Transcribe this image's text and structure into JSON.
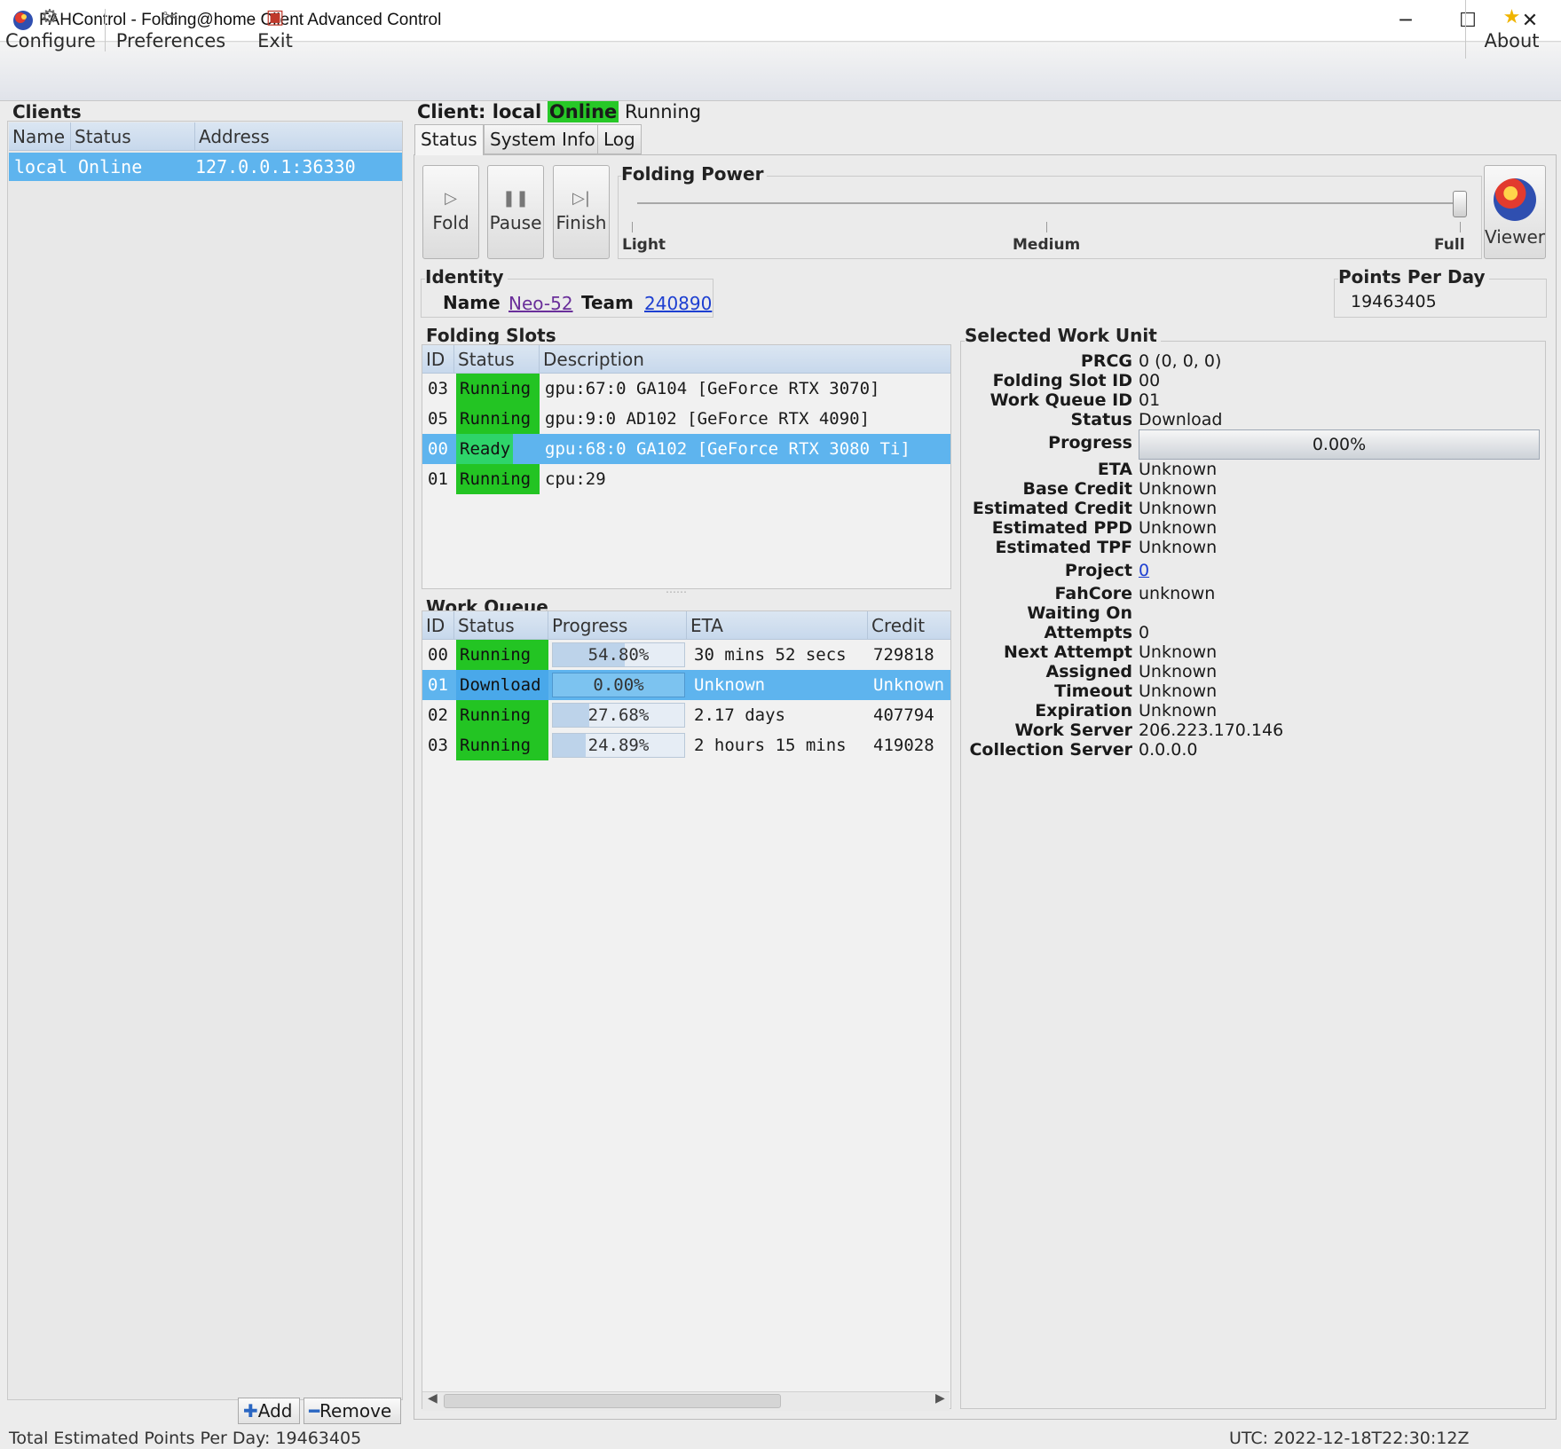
{
  "window": {
    "title": "FAHControl - Folding@home Client Advanced Control",
    "min": "─",
    "max": "☐",
    "close": "✕"
  },
  "toolbar": {
    "configure": "Configure",
    "preferences": "Preferences",
    "exit": "Exit",
    "about": "About"
  },
  "clients": {
    "title": "Clients",
    "columns": [
      "Name",
      "Status",
      "Address"
    ],
    "rows": [
      {
        "name": "local",
        "status": "Online",
        "address": "127.0.0.1:36330"
      }
    ],
    "add": "Add",
    "remove": "Remove"
  },
  "client_header": {
    "prefix": "Client: local",
    "online": "Online",
    "state": "Running"
  },
  "tabs": [
    "Status",
    "System Info",
    "Log"
  ],
  "controls": {
    "fold": "Fold",
    "pause": "Pause",
    "finish": "Finish",
    "viewer": "Viewer"
  },
  "folding_power": {
    "title": "Folding Power",
    "light": "Light",
    "medium": "Medium",
    "full": "Full",
    "level": "Full"
  },
  "identity": {
    "title": "Identity",
    "name_label": "Name",
    "name": "Neo-52",
    "team_label": "Team",
    "team": "240890"
  },
  "ppd": {
    "title": "Points Per Day",
    "value": "19463405"
  },
  "slots": {
    "title": "Folding Slots",
    "columns": [
      "ID",
      "Status",
      "Description"
    ],
    "rows": [
      {
        "id": "03",
        "status": "Running",
        "description": "gpu:67:0 GA104 [GeForce RTX 3070]"
      },
      {
        "id": "05",
        "status": "Running",
        "description": "gpu:9:0 AD102 [GeForce RTX 4090]"
      },
      {
        "id": "00",
        "status": "Ready",
        "description": "gpu:68:0 GA102 [GeForce RTX 3080 Ti]"
      },
      {
        "id": "01",
        "status": "Running",
        "description": "cpu:29"
      }
    ]
  },
  "queue": {
    "title": "Work Queue",
    "columns": [
      "ID",
      "Status",
      "Progress",
      "ETA",
      "Credit"
    ],
    "rows": [
      {
        "id": "00",
        "status": "Running",
        "progress": "54.80%",
        "fraction": 0.548,
        "eta": "30 mins 52 secs",
        "credit": "729818"
      },
      {
        "id": "01",
        "status": "Download",
        "progress": "0.00%",
        "fraction": 0.0,
        "eta": "Unknown",
        "credit": "Unknown"
      },
      {
        "id": "02",
        "status": "Running",
        "progress": "27.68%",
        "fraction": 0.2768,
        "eta": "2.17 days",
        "credit": "407794"
      },
      {
        "id": "03",
        "status": "Running",
        "progress": "24.89%",
        "fraction": 0.2489,
        "eta": "2 hours 15 mins",
        "credit": "419028"
      }
    ]
  },
  "selected_wu": {
    "title": "Selected Work Unit",
    "progress": "0.00%",
    "fields": [
      {
        "k": "PRCG",
        "v": "0 (0, 0, 0)"
      },
      {
        "k": "Folding Slot ID",
        "v": "00"
      },
      {
        "k": "Work Queue ID",
        "v": "01"
      },
      {
        "k": "Status",
        "v": "Download"
      },
      {
        "k": "Progress",
        "v": ""
      },
      {
        "k": "ETA",
        "v": "Unknown"
      },
      {
        "k": "Base Credit",
        "v": "Unknown"
      },
      {
        "k": "Estimated Credit",
        "v": "Unknown"
      },
      {
        "k": "Estimated PPD",
        "v": "Unknown"
      },
      {
        "k": "Estimated TPF",
        "v": "Unknown"
      },
      {
        "k": "Project",
        "v": "0"
      },
      {
        "k": "FahCore",
        "v": "unknown"
      },
      {
        "k": "Waiting On",
        "v": ""
      },
      {
        "k": "Attempts",
        "v": "0"
      },
      {
        "k": "Next Attempt",
        "v": "Unknown"
      },
      {
        "k": "Assigned",
        "v": "Unknown"
      },
      {
        "k": "Timeout",
        "v": "Unknown"
      },
      {
        "k": "Expiration",
        "v": "Unknown"
      },
      {
        "k": "Work Server",
        "v": "206.223.170.146"
      },
      {
        "k": "Collection Server",
        "v": "0.0.0.0"
      }
    ]
  },
  "statusbar": {
    "left": "Total Estimated Points Per Day: 19463405",
    "right": "UTC: 2022-12-18T22:30:12Z"
  },
  "icons": {
    "app": "fah-logo-icon",
    "configure": "gear-icon",
    "preferences": "tools-icon",
    "exit": "exit-door-icon",
    "about": "star-icon",
    "fold": "play-icon",
    "pause": "pause-icon",
    "finish": "skip-end-icon",
    "viewer": "globe-icon"
  },
  "colors": {
    "running": "#23c423",
    "ready": "#2ed46a",
    "selection": "#5eb4ee",
    "online": "#27c827",
    "link": "#1d3fd1"
  }
}
